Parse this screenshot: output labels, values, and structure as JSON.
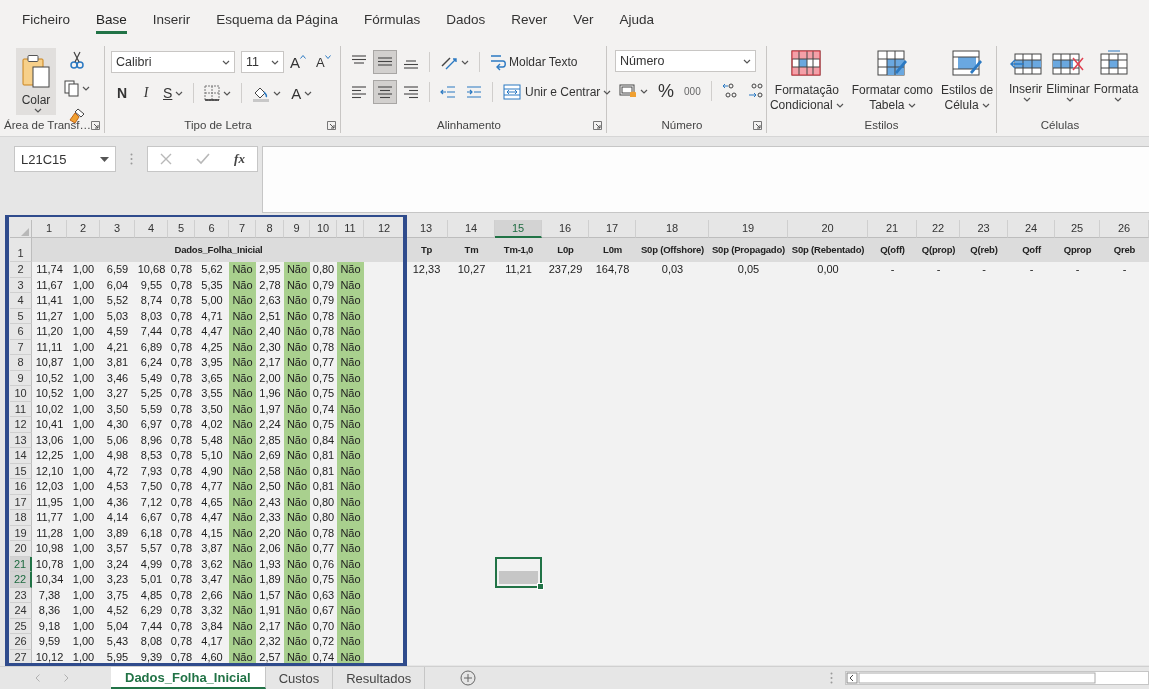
{
  "menu_tabs": [
    {
      "label": "Ficheiro",
      "selected": false
    },
    {
      "label": "Base",
      "selected": true
    },
    {
      "label": "Inserir",
      "selected": false
    },
    {
      "label": "Esquema da Página",
      "selected": false
    },
    {
      "label": "Fórmulas",
      "selected": false
    },
    {
      "label": "Dados",
      "selected": false
    },
    {
      "label": "Rever",
      "selected": false
    },
    {
      "label": "Ver",
      "selected": false
    },
    {
      "label": "Ajuda",
      "selected": false
    }
  ],
  "ribbon": {
    "clipboard": {
      "paste_label": "Colar",
      "group_label": "Área de Transf…"
    },
    "font": {
      "name": "Calibri",
      "size": "11",
      "grow_label": "A",
      "shrink_label": "A",
      "bold_label": "N",
      "italic_label": "I",
      "underline_label": "S",
      "color_label": "A",
      "group_label": "Tipo de Letra"
    },
    "alignment": {
      "vertical_buttons": [
        {
          "kind": "top",
          "selected": false
        },
        {
          "kind": "middle",
          "selected": true
        },
        {
          "kind": "bottom",
          "selected": false
        }
      ],
      "horizontal_buttons": [
        {
          "kind": "left",
          "selected": false
        },
        {
          "kind": "center",
          "selected": true
        },
        {
          "kind": "right",
          "selected": false
        }
      ],
      "wrap_label": "Moldar Texto",
      "merge_label": "Unir e Centrar",
      "group_label": "Alinhamento"
    },
    "number": {
      "format": "Número",
      "percent_label": "%",
      "thousands_label": "000",
      "group_label": "Número"
    },
    "styles": {
      "buttons": [
        {
          "kind": "conditional",
          "lines": [
            "Formatação",
            "Condicional"
          ]
        },
        {
          "kind": "table",
          "lines": [
            "Formatar como",
            "Tabela"
          ]
        },
        {
          "kind": "cell",
          "lines": [
            "Estilos de",
            "Célula"
          ]
        }
      ],
      "group_label": "Estilos"
    },
    "cells": {
      "buttons": [
        {
          "kind": "insert",
          "label": "Inserir"
        },
        {
          "kind": "delete",
          "label": "Eliminar"
        },
        {
          "kind": "format",
          "label": "Formata"
        }
      ],
      "group_label": "Células"
    }
  },
  "formula_bar": {
    "name_box": "L21C15",
    "function_label": "fx"
  },
  "sheet": {
    "columns": [
      {
        "header": "1",
        "selected": false,
        "highlighted": false
      },
      {
        "header": "2",
        "selected": false,
        "highlighted": false
      },
      {
        "header": "3",
        "selected": false,
        "highlighted": false
      },
      {
        "header": "4",
        "selected": false,
        "highlighted": false
      },
      {
        "header": "5",
        "selected": false,
        "highlighted": false
      },
      {
        "header": "6",
        "selected": false,
        "highlighted": false
      },
      {
        "header": "7",
        "selected": false,
        "highlighted": true
      },
      {
        "header": "8",
        "selected": false,
        "highlighted": false
      },
      {
        "header": "9",
        "selected": false,
        "highlighted": true
      },
      {
        "header": "10",
        "selected": false,
        "highlighted": false
      },
      {
        "header": "11",
        "selected": false,
        "highlighted": true
      },
      {
        "header": "12",
        "selected": false,
        "highlighted": false
      },
      {
        "header": "13",
        "selected": false,
        "highlighted": false
      },
      {
        "header": "14",
        "selected": false,
        "highlighted": false
      },
      {
        "header": "15",
        "selected": true,
        "highlighted": false
      },
      {
        "header": "16",
        "selected": false,
        "highlighted": false
      },
      {
        "header": "17",
        "selected": false,
        "highlighted": false
      },
      {
        "header": "18",
        "selected": false,
        "highlighted": false
      },
      {
        "header": "19",
        "selected": false,
        "highlighted": false
      },
      {
        "header": "20",
        "selected": false,
        "highlighted": false
      },
      {
        "header": "21",
        "selected": false,
        "highlighted": false
      },
      {
        "header": "22",
        "selected": false,
        "highlighted": false
      },
      {
        "header": "23",
        "selected": false,
        "highlighted": false
      },
      {
        "header": "24",
        "selected": false,
        "highlighted": false
      },
      {
        "header": "25",
        "selected": false,
        "highlighted": false
      },
      {
        "header": "26",
        "selected": false,
        "highlighted": false
      }
    ],
    "title_row": {
      "number": "1",
      "merged_title": "Dados_Folha_Inicial",
      "titles": [
        "Tp",
        "Tm",
        "Tm-1,0",
        "L0p",
        "L0m",
        "S0p (Offshore)",
        "S0p (Propagado)",
        "S0p (Rebentado)",
        "Q(off)",
        "Q(prop)",
        "Q(reb)",
        "Qoff",
        "Qprop",
        "Qreb"
      ]
    },
    "rows": [
      {
        "number": "2",
        "selected": false,
        "cells": [
          "11,74",
          "1,00",
          "6,59",
          "10,68",
          "0,78",
          "5,62",
          "Não",
          "2,95",
          "Não",
          "0,80",
          "Não"
        ],
        "more_cells": [
          "12,33",
          "10,27",
          "11,21",
          "237,29",
          "164,78",
          "0,03",
          "0,05",
          "0,00",
          "-",
          "-",
          "-",
          "-",
          "-",
          "-"
        ]
      },
      {
        "number": "3",
        "selected": false,
        "cells": [
          "11,67",
          "1,00",
          "6,04",
          "9,55",
          "0,78",
          "5,35",
          "Não",
          "2,78",
          "Não",
          "0,79",
          "Não"
        ]
      },
      {
        "number": "4",
        "selected": false,
        "cells": [
          "11,41",
          "1,00",
          "5,52",
          "8,74",
          "0,78",
          "5,00",
          "Não",
          "2,63",
          "Não",
          "0,79",
          "Não"
        ]
      },
      {
        "number": "5",
        "selected": false,
        "cells": [
          "11,27",
          "1,00",
          "5,03",
          "8,03",
          "0,78",
          "4,71",
          "Não",
          "2,51",
          "Não",
          "0,78",
          "Não"
        ]
      },
      {
        "number": "6",
        "selected": false,
        "cells": [
          "11,20",
          "1,00",
          "4,59",
          "7,44",
          "0,78",
          "4,47",
          "Não",
          "2,40",
          "Não",
          "0,78",
          "Não"
        ]
      },
      {
        "number": "7",
        "selected": false,
        "cells": [
          "11,11",
          "1,00",
          "4,21",
          "6,89",
          "0,78",
          "4,25",
          "Não",
          "2,30",
          "Não",
          "0,78",
          "Não"
        ]
      },
      {
        "number": "8",
        "selected": false,
        "cells": [
          "10,87",
          "1,00",
          "3,81",
          "6,24",
          "0,78",
          "3,95",
          "Não",
          "2,17",
          "Não",
          "0,77",
          "Não"
        ]
      },
      {
        "number": "9",
        "selected": false,
        "cells": [
          "10,52",
          "1,00",
          "3,46",
          "5,49",
          "0,78",
          "3,65",
          "Não",
          "2,00",
          "Não",
          "0,75",
          "Não"
        ]
      },
      {
        "number": "10",
        "selected": false,
        "cells": [
          "10,52",
          "1,00",
          "3,27",
          "5,25",
          "0,78",
          "3,55",
          "Não",
          "1,96",
          "Não",
          "0,75",
          "Não"
        ]
      },
      {
        "number": "11",
        "selected": false,
        "cells": [
          "10,02",
          "1,00",
          "3,50",
          "5,59",
          "0,78",
          "3,50",
          "Não",
          "1,97",
          "Não",
          "0,74",
          "Não"
        ]
      },
      {
        "number": "12",
        "selected": false,
        "cells": [
          "10,41",
          "1,00",
          "4,30",
          "6,97",
          "0,78",
          "4,02",
          "Não",
          "2,24",
          "Não",
          "0,75",
          "Não"
        ]
      },
      {
        "number": "13",
        "selected": false,
        "cells": [
          "13,06",
          "1,00",
          "5,06",
          "8,96",
          "0,78",
          "5,48",
          "Não",
          "2,85",
          "Não",
          "0,84",
          "Não"
        ]
      },
      {
        "number": "14",
        "selected": false,
        "cells": [
          "12,25",
          "1,00",
          "4,98",
          "8,53",
          "0,78",
          "5,10",
          "Não",
          "2,69",
          "Não",
          "0,81",
          "Não"
        ]
      },
      {
        "number": "15",
        "selected": false,
        "cells": [
          "12,10",
          "1,00",
          "4,72",
          "7,93",
          "0,78",
          "4,90",
          "Não",
          "2,58",
          "Não",
          "0,81",
          "Não"
        ]
      },
      {
        "number": "16",
        "selected": false,
        "cells": [
          "12,03",
          "1,00",
          "4,53",
          "7,50",
          "0,78",
          "4,77",
          "Não",
          "2,50",
          "Não",
          "0,81",
          "Não"
        ]
      },
      {
        "number": "17",
        "selected": false,
        "cells": [
          "11,95",
          "1,00",
          "4,36",
          "7,12",
          "0,78",
          "4,65",
          "Não",
          "2,43",
          "Não",
          "0,80",
          "Não"
        ]
      },
      {
        "number": "18",
        "selected": false,
        "cells": [
          "11,77",
          "1,00",
          "4,14",
          "6,67",
          "0,78",
          "4,47",
          "Não",
          "2,33",
          "Não",
          "0,80",
          "Não"
        ]
      },
      {
        "number": "19",
        "selected": false,
        "cells": [
          "11,28",
          "1,00",
          "3,89",
          "6,18",
          "0,78",
          "4,15",
          "Não",
          "2,20",
          "Não",
          "0,78",
          "Não"
        ]
      },
      {
        "number": "20",
        "selected": false,
        "cells": [
          "10,98",
          "1,00",
          "3,57",
          "5,57",
          "0,78",
          "3,87",
          "Não",
          "2,06",
          "Não",
          "0,77",
          "Não"
        ]
      },
      {
        "number": "21",
        "selected": true,
        "cells": [
          "10,78",
          "1,00",
          "3,24",
          "4,99",
          "0,78",
          "3,62",
          "Não",
          "1,93",
          "Não",
          "0,76",
          "Não"
        ]
      },
      {
        "number": "22",
        "selected": true,
        "cells": [
          "10,34",
          "1,00",
          "3,23",
          "5,01",
          "0,78",
          "3,47",
          "Não",
          "1,89",
          "Não",
          "0,75",
          "Não"
        ]
      },
      {
        "number": "23",
        "selected": false,
        "cells": [
          "7,38",
          "1,00",
          "3,75",
          "4,85",
          "0,78",
          "2,66",
          "Não",
          "1,57",
          "Não",
          "0,63",
          "Não"
        ]
      },
      {
        "number": "24",
        "selected": false,
        "cells": [
          "8,36",
          "1,00",
          "4,52",
          "6,29",
          "0,78",
          "3,32",
          "Não",
          "1,91",
          "Não",
          "0,67",
          "Não"
        ]
      },
      {
        "number": "25",
        "selected": false,
        "cells": [
          "9,18",
          "1,00",
          "5,04",
          "7,44",
          "0,78",
          "3,84",
          "Não",
          "2,17",
          "Não",
          "0,70",
          "Não"
        ]
      },
      {
        "number": "26",
        "selected": false,
        "cells": [
          "9,59",
          "1,00",
          "5,43",
          "8,08",
          "0,78",
          "4,17",
          "Não",
          "2,32",
          "Não",
          "0,72",
          "Não"
        ]
      },
      {
        "number": "27",
        "selected": false,
        "cells": [
          "10,12",
          "1,00",
          "5,95",
          "9,39",
          "0,78",
          "4,60",
          "Não",
          "2,57",
          "Não",
          "0,74",
          "Não"
        ]
      }
    ]
  },
  "sheet_tabs": [
    {
      "label": "Dados_Folha_Inicial",
      "selected": true
    },
    {
      "label": "Custos",
      "selected": false
    },
    {
      "label": "Resultados",
      "selected": false
    }
  ]
}
